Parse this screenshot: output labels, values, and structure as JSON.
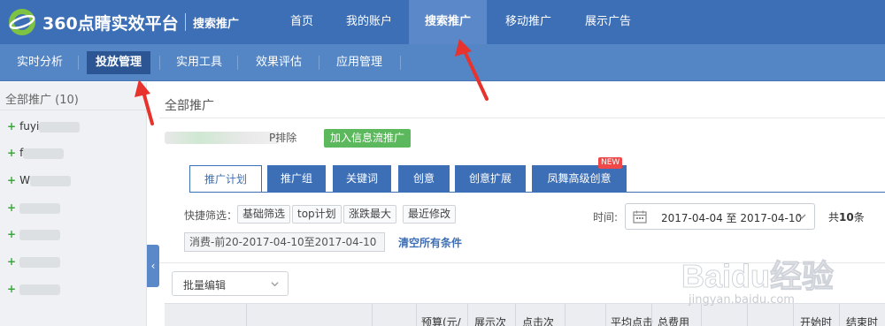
{
  "header": {
    "brand": "360点睛实效平台",
    "sub_brand": "搜索推广",
    "nav": [
      {
        "label": "首页",
        "active": false
      },
      {
        "label": "我的账户",
        "active": false
      },
      {
        "label": "搜索推广",
        "active": true
      },
      {
        "label": "移动推广",
        "active": false
      },
      {
        "label": "展示广告",
        "active": false
      }
    ]
  },
  "subnav": [
    {
      "label": "实时分析",
      "active": false
    },
    {
      "label": "投放管理",
      "active": true
    },
    {
      "label": "实用工具",
      "active": false
    },
    {
      "label": "效果评估",
      "active": false
    },
    {
      "label": "应用管理",
      "active": false
    }
  ],
  "sidebar": {
    "title": "全部推广 (10)",
    "items": [
      {
        "label": "fuyi"
      },
      {
        "label": "f"
      },
      {
        "label": "W"
      },
      {
        "label": ""
      },
      {
        "label": ""
      },
      {
        "label": ""
      },
      {
        "label": ""
      }
    ]
  },
  "main": {
    "title": "全部推广",
    "exclude_label": "P排除",
    "infoflow_button": "加入信息流推广",
    "tabs": [
      {
        "label": "推广计划",
        "active": true
      },
      {
        "label": "推广组",
        "active": false
      },
      {
        "label": "关键词",
        "active": false
      },
      {
        "label": "创意",
        "active": false
      },
      {
        "label": "创意扩展",
        "active": false
      },
      {
        "label": "凤舞高级创意",
        "active": false
      }
    ],
    "new_badge": "NEW",
    "filter": {
      "label": "快捷筛选：",
      "chips": [
        "基础筛选",
        "top计划",
        "涨跌最大",
        "最近修改"
      ],
      "condition": "消费-前20-2017-04-10至2017-04-10",
      "clear_label": "清空所有条件"
    },
    "time": {
      "label": "时间:",
      "range": "2017-04-04 至 2017-04-10",
      "count_prefix": "共",
      "count": "10",
      "count_suffix": "条"
    },
    "batch_edit": "批量编辑",
    "table_headers": [
      "预算(元/",
      "展示次",
      "点击次",
      "平均点击",
      "总费用",
      "开始时",
      "结束时"
    ]
  },
  "watermark": {
    "logo": "Baidu经验",
    "url": "jingyan.baidu.com"
  },
  "colors": {
    "primary": "#3d6fb6",
    "subnav": "#5485c4",
    "active_subnav": "#2c5594",
    "success": "#5cb85c",
    "badge": "#f04848",
    "annotation_arrow": "#e8322d"
  }
}
